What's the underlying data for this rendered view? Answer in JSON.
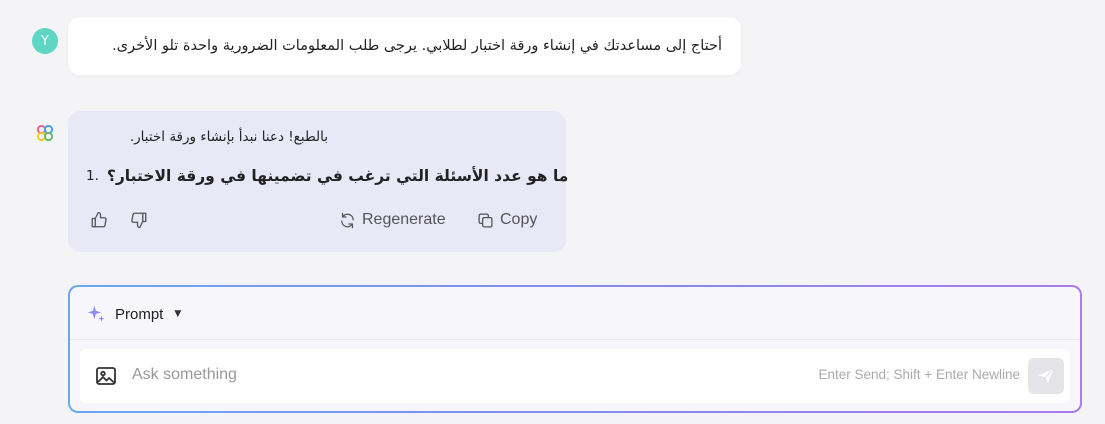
{
  "user_message": {
    "avatar_letter": "Y",
    "text": "أحتاج إلى مساعدتك في إنشاء ورقة اختبار لطلابي. يرجى طلب المعلومات الضرورية واحدة تلو الأخرى."
  },
  "assistant_message": {
    "intro": "بالطبع! دعنا نبدأ بإنشاء ورقة اختبار.",
    "question_number": "1.",
    "question_text": "ما هو عدد الأسئلة التي ترغب في تضمينها في ورقة الاختبار؟",
    "actions": {
      "like_icon": "thumbs-up-icon",
      "dislike_icon": "thumbs-down-icon",
      "regenerate_label": "Regenerate",
      "copy_label": "Copy"
    }
  },
  "composer": {
    "mode_label": "Prompt",
    "input_placeholder": "Ask something",
    "input_value": "",
    "hint": "Enter Send; Shift + Enter Newline"
  },
  "colors": {
    "background": "#f4f4f6",
    "user_avatar": "#5fd6c4",
    "assistant_bubble": "#e9e8f7",
    "composer_border_start": "#6aa8f2",
    "composer_border_end": "#a77df0"
  }
}
